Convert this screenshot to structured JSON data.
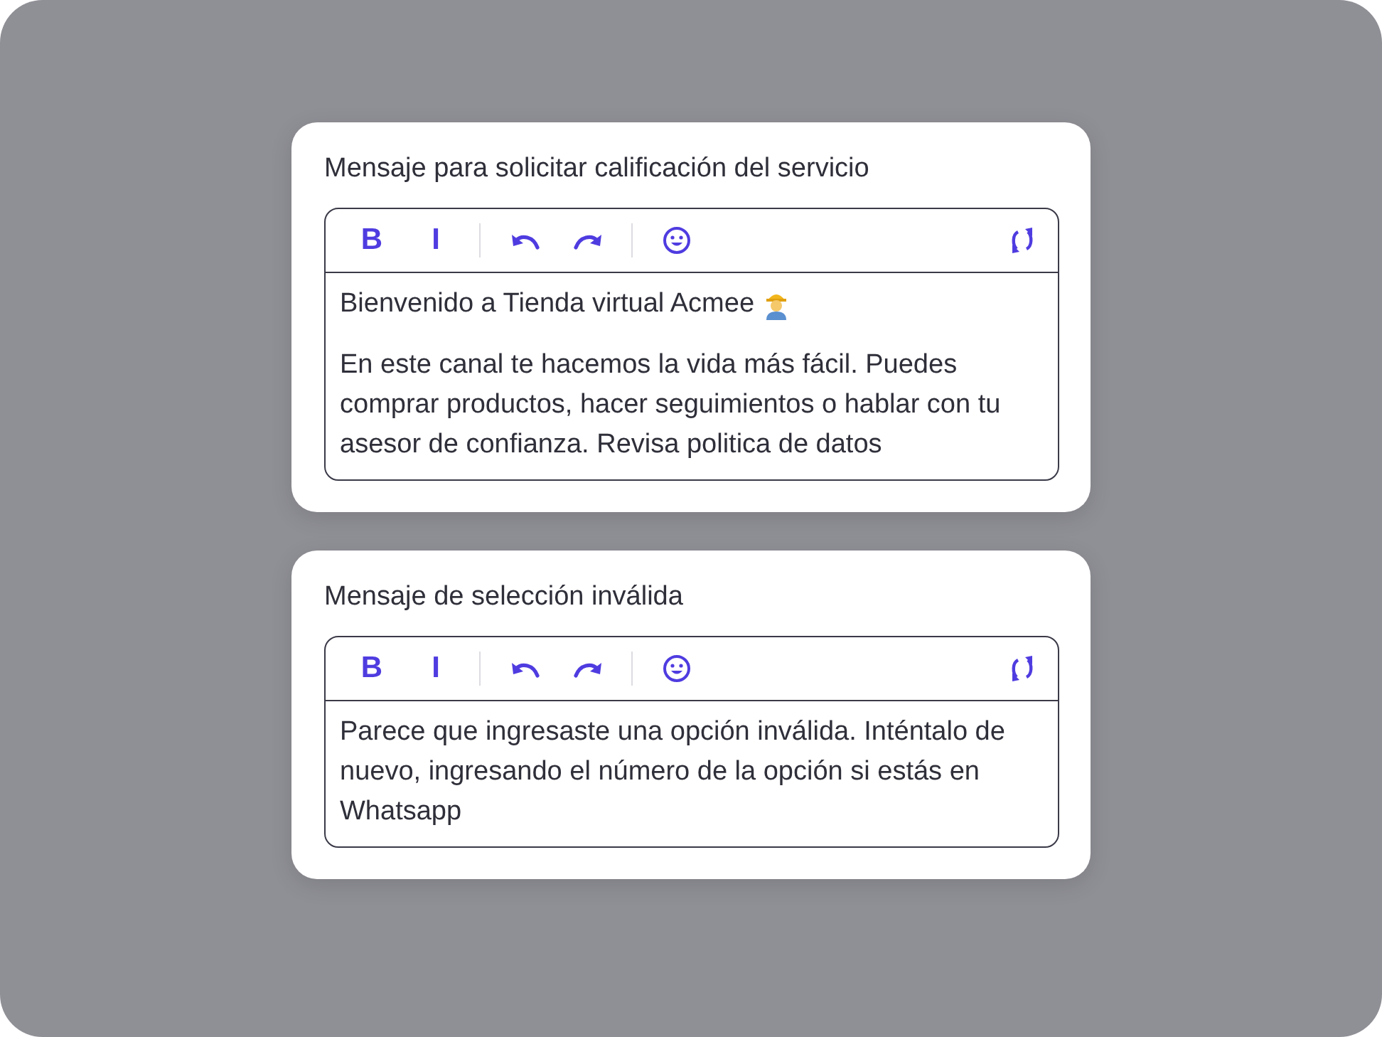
{
  "editors": [
    {
      "title": "Mensaje para solicitar calificación del servicio",
      "toolbar": {
        "bold": "B",
        "italic": "I"
      },
      "paragraphs": [
        {
          "text": "Bienvenido a Tienda virtual Acmee",
          "worker_emoji": true
        },
        {
          "text": "En este canal te hacemos la vida más fácil. Puedes comprar productos, hacer seguimientos o hablar con tu asesor de confianza. Revisa politica de datos"
        }
      ]
    },
    {
      "title": "Mensaje de selección inválida",
      "toolbar": {
        "bold": "B",
        "italic": "I"
      },
      "paragraphs": [
        {
          "text": "Parece que ingresaste una opción inválida. Inténtalo de nuevo, ingresando el número de la opción si estás en Whatsapp"
        }
      ]
    }
  ]
}
